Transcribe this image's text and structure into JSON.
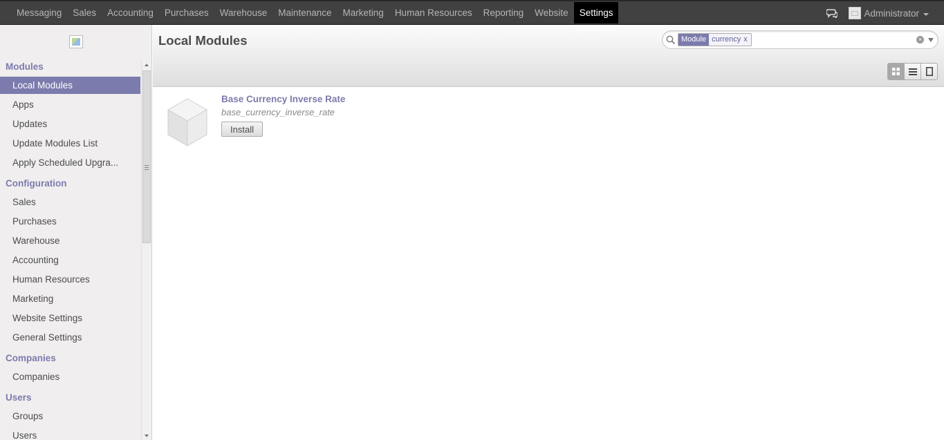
{
  "topbar": {
    "menu": [
      "Messaging",
      "Sales",
      "Accounting",
      "Purchases",
      "Warehouse",
      "Maintenance",
      "Marketing",
      "Human Resources",
      "Reporting",
      "Website",
      "Settings"
    ],
    "active": "Settings",
    "user": "Administrator"
  },
  "sidebar": {
    "sections": [
      {
        "title": "Modules",
        "items": [
          "Local Modules",
          "Apps",
          "Updates",
          "Update Modules List",
          "Apply Scheduled Upgra..."
        ]
      },
      {
        "title": "Configuration",
        "items": [
          "Sales",
          "Purchases",
          "Warehouse",
          "Accounting",
          "Human Resources",
          "Marketing",
          "Website Settings",
          "General Settings"
        ]
      },
      {
        "title": "Companies",
        "items": [
          "Companies"
        ]
      },
      {
        "title": "Users",
        "items": [
          "Groups",
          "Users"
        ]
      }
    ],
    "active_item": "Local Modules"
  },
  "header": {
    "title": "Local Modules",
    "search": {
      "facet_category": "Module",
      "facet_value": "currency",
      "facet_remove": "x"
    }
  },
  "modules": [
    {
      "name": "Base Currency Inverse Rate",
      "technical_name": "base_currency_inverse_rate",
      "button": "Install"
    }
  ],
  "colors": {
    "accent": "#7c7bad",
    "topbar": "#414141"
  }
}
